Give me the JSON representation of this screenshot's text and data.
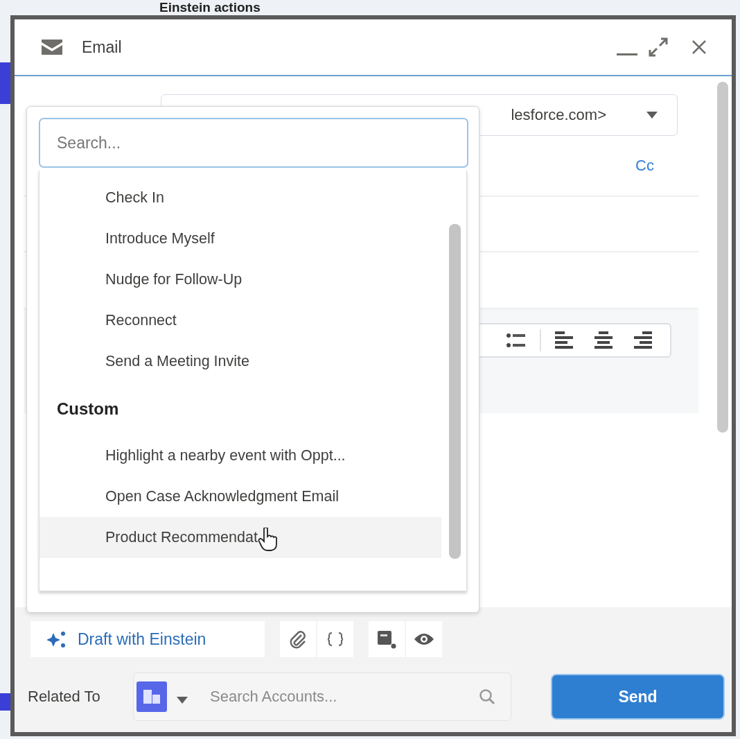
{
  "background": {
    "heading": "Einstein actions"
  },
  "window": {
    "title": "Email"
  },
  "from_field": {
    "value": "lesforce.com>"
  },
  "cc_link": "Cc",
  "template_menu": {
    "search": {
      "placeholder": "Search..."
    },
    "groups": [
      {
        "items": [
          {
            "label": "Check In",
            "hovered": false
          },
          {
            "label": "Introduce Myself",
            "hovered": false
          },
          {
            "label": "Nudge for Follow-Up",
            "hovered": false
          },
          {
            "label": "Reconnect",
            "hovered": false
          },
          {
            "label": "Send a Meeting Invite",
            "hovered": false
          }
        ]
      },
      {
        "heading": "Custom",
        "items": [
          {
            "label": "Highlight a nearby event with Oppt...",
            "hovered": false
          },
          {
            "label": "Open Case Acknowledgment Email",
            "hovered": false
          },
          {
            "label": "Product Recommendat",
            "hovered": true
          }
        ]
      }
    ]
  },
  "composer_toolbar": {
    "draft_button": "Draft with Einstein"
  },
  "related_to": {
    "label": "Related To",
    "search": {
      "placeholder": "Search Accounts..."
    }
  },
  "send_button": "Send"
}
